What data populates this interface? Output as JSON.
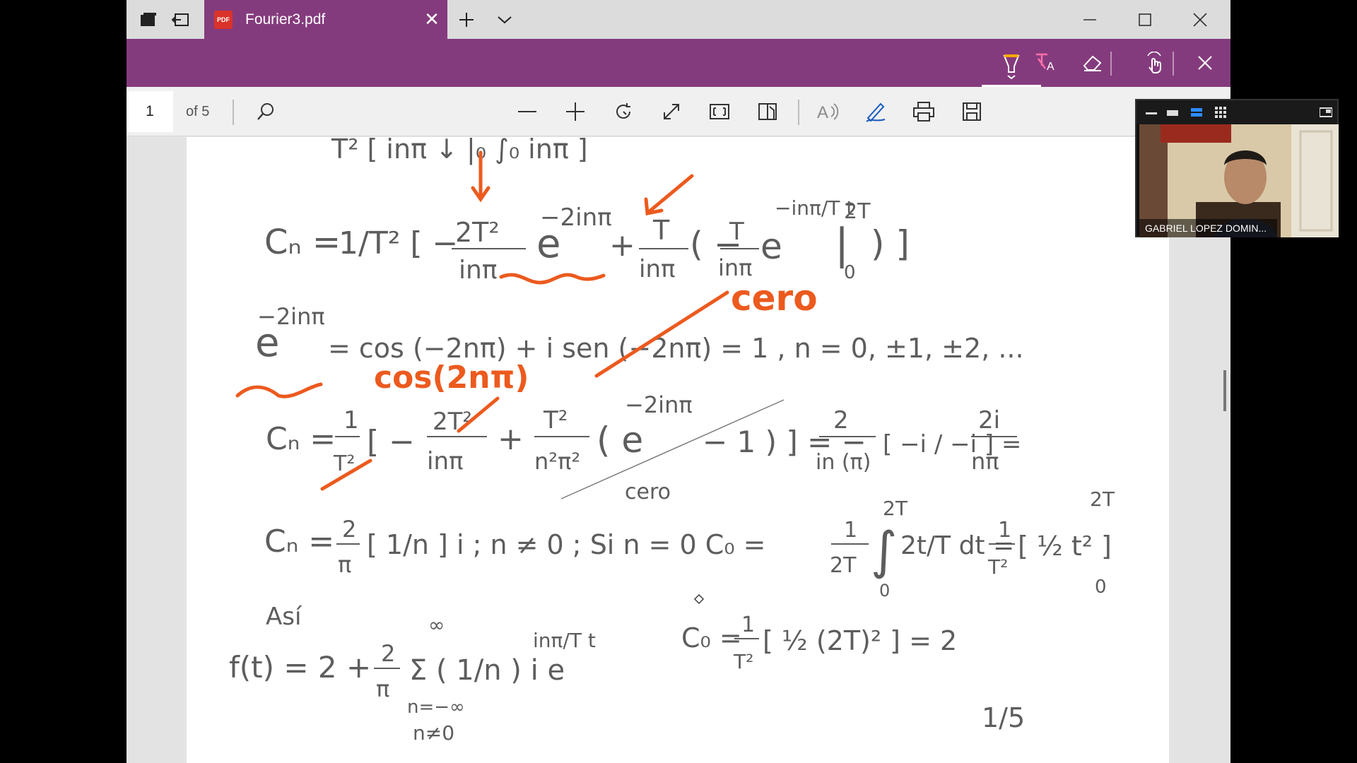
{
  "tab": {
    "title": "Fourier3.pdf",
    "icon": "pdf-file-icon",
    "pdf_label": "PDF"
  },
  "window_buttons": [
    "minimize-icon",
    "maximize-icon",
    "close-icon"
  ],
  "ink_toolbar": {
    "tools": [
      "highlighter-icon",
      "text-highlight-icon",
      "eraser-icon",
      "touch-writing-icon",
      "close-icon"
    ]
  },
  "pdf_toolbar": {
    "page_number": "1",
    "page_count": "of 5"
  },
  "document": {
    "lines": {
      "l0": "T² [  inπ  ↓   |₀   ∫₀  inπ   ]",
      "l1a": "Cₙ =",
      "l1b": "1/T² [ −",
      "l1c": "2T²",
      "l1d": "inπ",
      "l1e": "e",
      "l1f": "−2inπ",
      "l1g": "+",
      "l1h": "T",
      "l1i": "inπ",
      "l1j": "( −",
      "l1k": "T",
      "l1l": "inπ",
      "l1m": "e",
      "l1n": "−inπ/T t",
      "l1o": "|",
      "l1p": "2T",
      "l1q": "0",
      "l1r": ") ]",
      "l2a": "e",
      "l2b": "−2inπ",
      "l2c": "= cos (−2nπ) + i sen (−2nπ) = 1   ,  n = 0, ±1, ±2, ...",
      "l3a": "Cₙ =",
      "l3b": "1",
      "l3c": "T²",
      "l3d": "[ −",
      "l3e": "2T²",
      "l3f": "inπ",
      "l3g": "+",
      "l3h": "T²",
      "l3i": "n²π²",
      "l3j": "( e",
      "l3k": "−2inπ",
      "l3l": "− 1 ) ] = −",
      "l3m": "2",
      "l3n": "in (π)",
      "l3o": "[ −i / −i ] =",
      "l3p": "2i",
      "l3q": "nπ",
      "l3r": "cero",
      "l4a": "Cₙ = ",
      "l4b": "2",
      "l4c": "π",
      "l4d": "[ 1/n ] i  ;   n ≠ 0  ;   Si  n = 0   C₀ =",
      "l4e": "1",
      "l4f": "2T",
      "l4g": "∫",
      "l4h": "2T",
      "l4i": "0",
      "l4j": "2t/T dt =",
      "l4k": "1",
      "l4l": "T²",
      "l4m": "[ ½ t² ]",
      "l4n": "2T",
      "l4o": "0",
      "l5a": "Así",
      "l5b": "∞",
      "l5c": "f(t) = 2 +",
      "l5d": "2",
      "l5e": "π",
      "l5f": "Σ ( 1/n ) i e",
      "l5g": "inπ/T t",
      "l5h": "n=−∞",
      "l5i": "n≠0",
      "l5j": "C₀ =",
      "l5k": "1",
      "l5l": "T²",
      "l5m": "[ ½ (2T)² ] = 2",
      "page_mark": "1/5"
    },
    "annotations": {
      "cero_top": "cero",
      "cos_label": "cos(2nπ)"
    }
  },
  "video": {
    "participant_name": "GABRIEL LOPEZ DOMIN...",
    "controls": [
      "minimize-icon",
      "restore-icon",
      "speaker-view-icon",
      "gallery-view-icon",
      "popout-icon"
    ]
  }
}
